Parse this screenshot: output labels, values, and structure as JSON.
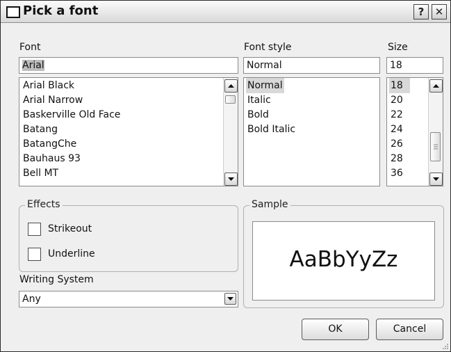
{
  "window": {
    "title": "Pick a font",
    "help_label": "?",
    "close_label": "✕"
  },
  "icons": {
    "window": "window-icon",
    "help": "help-icon",
    "close": "close-icon",
    "up": "chevron-up-icon",
    "down": "chevron-down-icon",
    "grip": "resize-grip-icon"
  },
  "font": {
    "label": "Font",
    "value": "Arial",
    "items": [
      "Arial Black",
      "Arial Narrow",
      "Baskerville Old Face",
      "Batang",
      "BatangChe",
      "Bauhaus 93",
      "Bell MT"
    ]
  },
  "style": {
    "label": "Font style",
    "value": "Normal",
    "items": [
      "Normal",
      "Italic",
      "Bold",
      "Bold Italic"
    ],
    "selected": "Normal"
  },
  "size": {
    "label": "Size",
    "value": "18",
    "items": [
      "18",
      "20",
      "22",
      "24",
      "26",
      "28",
      "36"
    ],
    "selected": "18"
  },
  "effects": {
    "title": "Effects",
    "strikeout": {
      "label": "Strikeout",
      "checked": false
    },
    "underline": {
      "label": "Underline",
      "checked": false
    }
  },
  "writing_system": {
    "label": "Writing System",
    "value": "Any"
  },
  "sample": {
    "title": "Sample",
    "text": "AaBbYyZz"
  },
  "buttons": {
    "ok": "OK",
    "cancel": "Cancel"
  }
}
